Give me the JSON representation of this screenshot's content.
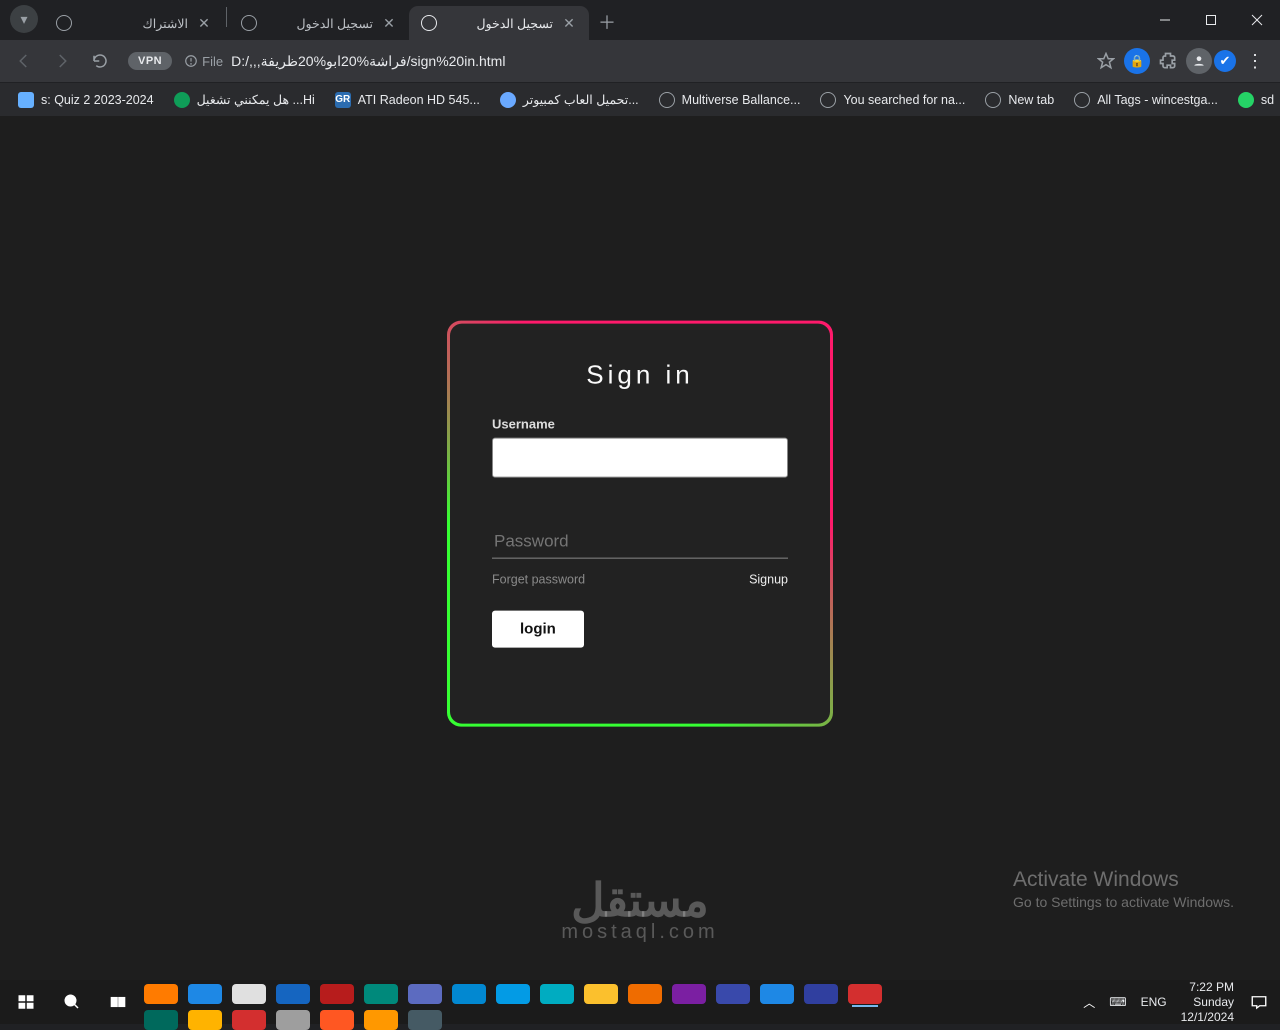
{
  "browser": {
    "tabs": [
      {
        "title": "الاشتراك"
      },
      {
        "title": "تسجيل الدخول"
      },
      {
        "title": "تسجيل الدخول"
      }
    ],
    "address": {
      "scheme_label": "File",
      "url": "D:/,,,فراشة%20ابو%20ظريفة/sign%20in.html"
    },
    "vpn_label": "VPN"
  },
  "bookmarks": [
    {
      "label": "s: Quiz 2 2023-2024",
      "color": "#66b0ff"
    },
    {
      "label": "هل يمكنني تشغيل ...Hi",
      "color": "#0f9d58"
    },
    {
      "label": "ATI Radeon HD 545...",
      "color": "#2b6cb0"
    },
    {
      "label": "تحميل العاب كمبيوتر...",
      "color": "#6aa9ff"
    },
    {
      "label": "Multiverse Ballance...",
      "color": "#777"
    },
    {
      "label": "You searched for na...",
      "color": "#777"
    },
    {
      "label": "New tab",
      "color": "#777"
    },
    {
      "label": "All Tags - wincestga...",
      "color": "#777"
    },
    {
      "label": "sd",
      "color": "#25d366"
    }
  ],
  "page": {
    "heading": "Sign in",
    "username_label": "Username",
    "username_value": "",
    "password_placeholder": "Password",
    "forget": "Forget password",
    "signup": "Signup",
    "login": "login"
  },
  "activate": {
    "line1": "Activate Windows",
    "line2": "Go to Settings to activate Windows."
  },
  "watermark": {
    "big": "مستقل",
    "small": "mostaql.com"
  },
  "tray": {
    "lang": "ENG",
    "time": "7:22 PM",
    "day": "Sunday",
    "date": "12/1/2024"
  },
  "task_icons": [
    "#ff7b00",
    "#1e88e5",
    "#e0e0e0",
    "#1565c0",
    "#b71c1c",
    "#00897b",
    "#5c6bc0",
    "#0288d1",
    "#039be5",
    "#00acc1",
    "#fbc02d",
    "#ef6c00",
    "#7b1fa2",
    "#3949ab",
    "#1e88e5",
    "#303f9f",
    "#d32f2f",
    "#00695c",
    "#ffb300",
    "#d32f2f",
    "#9e9e9e",
    "#ff5722",
    "#ff9800",
    "#455a64"
  ]
}
